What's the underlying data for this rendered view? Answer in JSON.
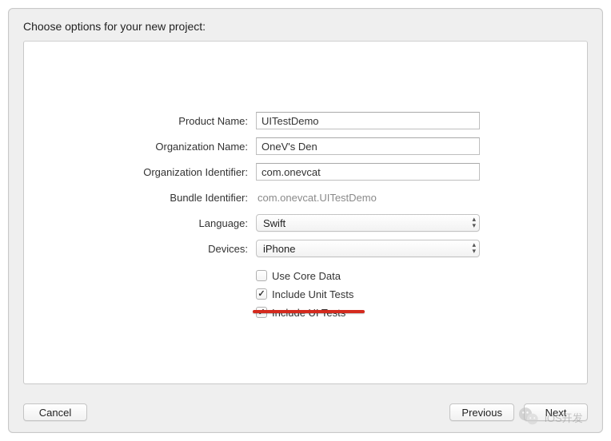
{
  "heading": "Choose options for your new project:",
  "form": {
    "productName": {
      "label": "Product Name:",
      "value": "UITestDemo"
    },
    "orgName": {
      "label": "Organization Name:",
      "value": "OneV's Den"
    },
    "orgIdentifier": {
      "label": "Organization Identifier:",
      "value": "com.onevcat"
    },
    "bundleIdentifier": {
      "label": "Bundle Identifier:",
      "value": "com.onevcat.UITestDemo"
    },
    "language": {
      "label": "Language:",
      "selected": "Swift"
    },
    "devices": {
      "label": "Devices:",
      "selected": "iPhone"
    }
  },
  "checkboxes": {
    "coreData": {
      "label": "Use Core Data",
      "checked": false
    },
    "unitTests": {
      "label": "Include Unit Tests",
      "checked": true
    },
    "uiTests": {
      "label": "Include UI Tests",
      "checked": true
    }
  },
  "buttons": {
    "cancel": "Cancel",
    "previous": "Previous",
    "next": "Next"
  },
  "watermark": "iOS开发"
}
